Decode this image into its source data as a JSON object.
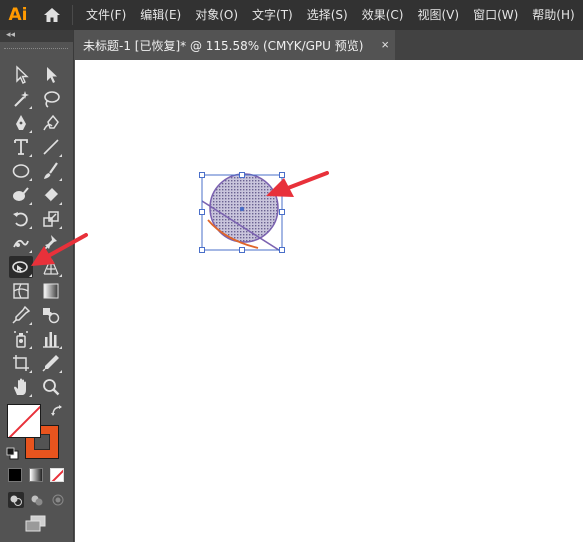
{
  "app": {
    "logo_text": "Ai"
  },
  "menu": {
    "items": [
      "文件(F)",
      "编辑(E)",
      "对象(O)",
      "文字(T)",
      "选择(S)",
      "效果(C)",
      "视图(V)",
      "窗口(W)",
      "帮助(H)"
    ]
  },
  "document_tab": {
    "title": "未标题-1 [已恢复]* @ 115.58% (CMYK/GPU 预览)",
    "close_label": "×"
  },
  "toolbar": {
    "collapse_label": "◂◂",
    "tools": [
      "selection-tool",
      "direct-selection-tool",
      "magic-wand-tool",
      "lasso-tool",
      "pen-tool",
      "curvature-tool",
      "type-tool",
      "line-segment-tool",
      "ellipse-tool",
      "paintbrush-tool",
      "shaper-tool",
      "eraser-tool",
      "rotate-tool",
      "scale-tool",
      "puppet-warp-tool",
      "pin-tool",
      "shape-builder-tool",
      "perspective-grid-tool",
      "mesh-tool",
      "gradient-tool",
      "eyedropper-tool",
      "blend-tool",
      "symbol-sprayer-tool",
      "column-graph-tool",
      "artboard-tool",
      "slice-tool",
      "hand-tool",
      "zoom-tool"
    ],
    "active_tool": "shape-builder-tool",
    "fill_color": "#ffffff",
    "stroke_color": "#e8541e"
  },
  "colors": {
    "accent_arrow": "#e8313a",
    "selection": "#4a6fc9",
    "circle_fill": "#b9b4cf",
    "line_orange": "#e0662a",
    "line_purple": "#7b62b0"
  }
}
